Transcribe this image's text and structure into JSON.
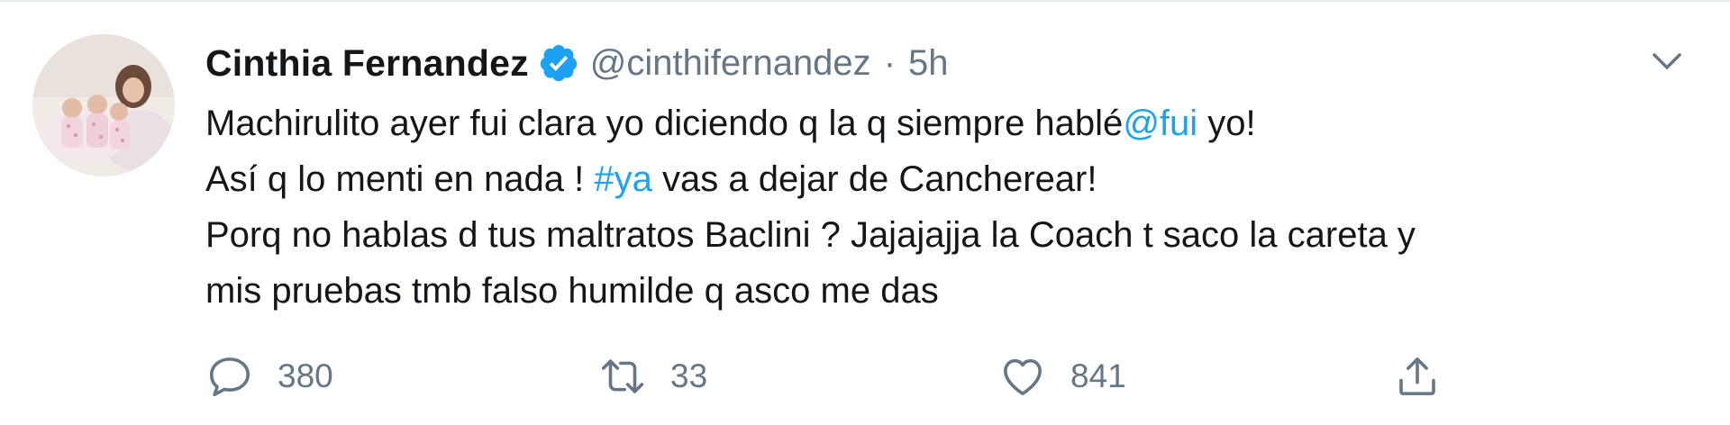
{
  "author": {
    "display_name": "Cinthia Fernandez",
    "handle": "@cinthifernandez",
    "separator": "·",
    "time": "5h",
    "verified": true,
    "avatar_icon": "avatar-photo"
  },
  "tweet": {
    "line1": {
      "text_a": "Machirulito ayer fui clara yo diciendo q la q siempre hablé",
      "mention": "@fui",
      "text_b": " yo!"
    },
    "line2": {
      "text_a": "Así q lo menti en nada ! ",
      "hashtag": "#ya",
      "text_b": " vas a dejar de Cancherear!"
    },
    "line3": "Porq no hablas d tus maltratos Baclini ? Jajajajja la Coach t saco la careta y",
    "line4": "mis pruebas tmb falso humilde q asco me das"
  },
  "actions": {
    "reply": {
      "icon": "reply-icon",
      "count": "380"
    },
    "retweet": {
      "icon": "retweet-icon",
      "count": "33"
    },
    "like": {
      "icon": "heart-icon",
      "count": "841"
    },
    "share": {
      "icon": "share-icon"
    }
  },
  "menu": {
    "icon": "chevron-down-icon"
  },
  "colors": {
    "link": "#1da1f2",
    "text": "#14171a",
    "muted": "#657786",
    "verified": "#1da1f2"
  }
}
